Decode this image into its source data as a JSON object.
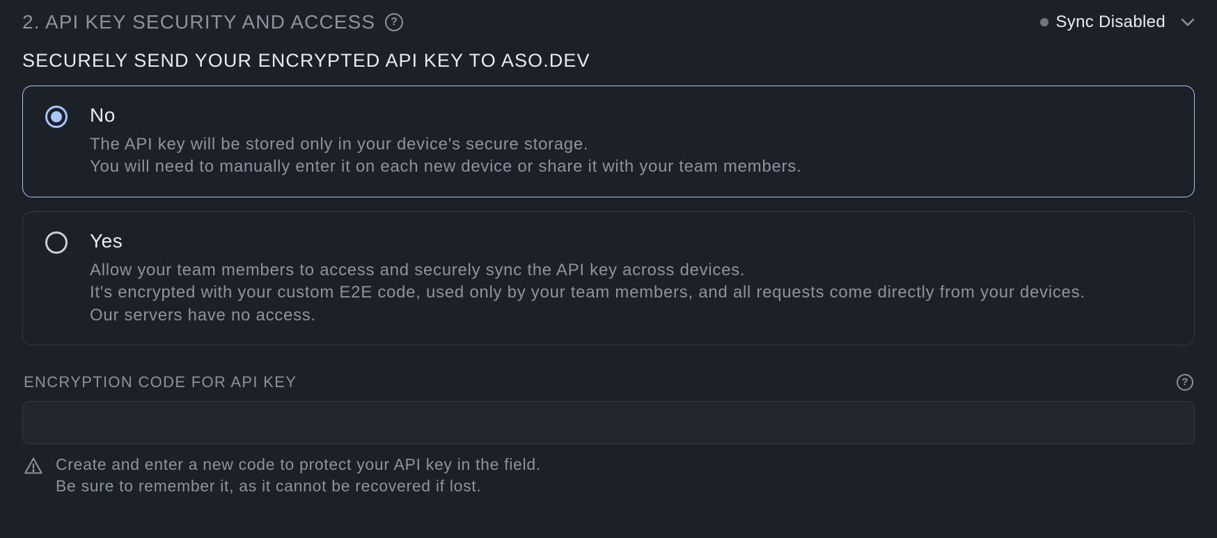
{
  "header": {
    "title": "2. API KEY SECURITY AND ACCESS",
    "sync_status": "Sync Disabled"
  },
  "subtitle": "SECURELY SEND YOUR ENCRYPTED API KEY TO ASO.DEV",
  "options": {
    "no": {
      "title": "No",
      "desc": "The API key will be stored only in your device's secure storage.\nYou will need to manually enter it on each new device or share it with your team members."
    },
    "yes": {
      "title": "Yes",
      "desc": "Allow your team members to access and securely sync the API key across devices.\nIt's encrypted with your custom E2E code, used only by your team members, and all requests come directly from your devices.\nOur servers have no access."
    }
  },
  "encryption": {
    "label": "ENCRYPTION CODE FOR API KEY",
    "value": "",
    "hint": "Create and enter a new code to protect your API key in the field.\nBe sure to remember it, as it cannot be recovered if lost."
  }
}
